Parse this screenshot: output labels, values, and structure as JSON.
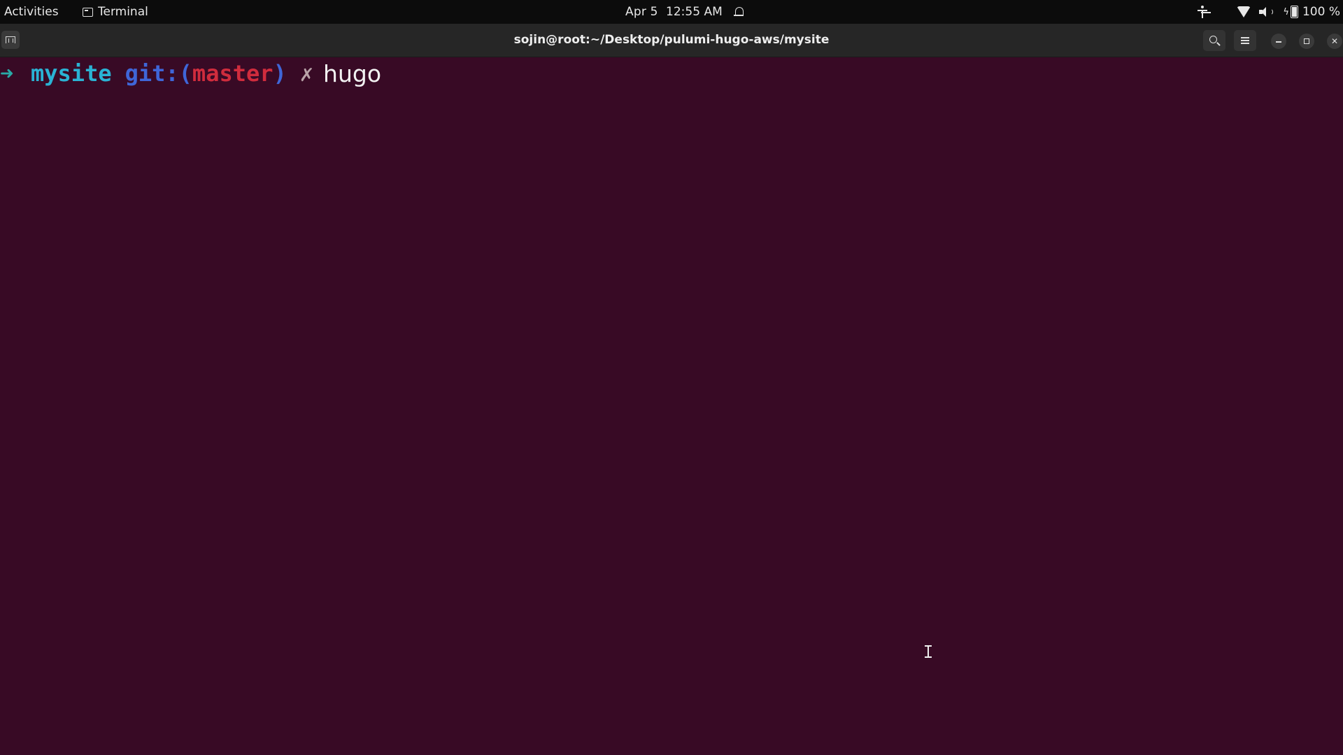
{
  "topbar": {
    "activities_label": "Activities",
    "app_name": "Terminal",
    "date": "Apr 5",
    "time": "12:55 AM",
    "battery_percent": "100 %"
  },
  "window": {
    "title": "sojin@root:~/Desktop/pulumi-hugo-aws/mysite"
  },
  "terminal": {
    "prompt_arrow": "➜",
    "directory": "mysite",
    "git_label": "git:(",
    "branch": "master",
    "git_close": ")",
    "dirty_mark": "✗",
    "command": "hugo"
  },
  "colors": {
    "terminal_background": "#380a25",
    "prompt_arrow": "#29a9a6",
    "directory": "#2ab3d4",
    "git": "#3f66d8",
    "branch": "#d02c3d"
  }
}
